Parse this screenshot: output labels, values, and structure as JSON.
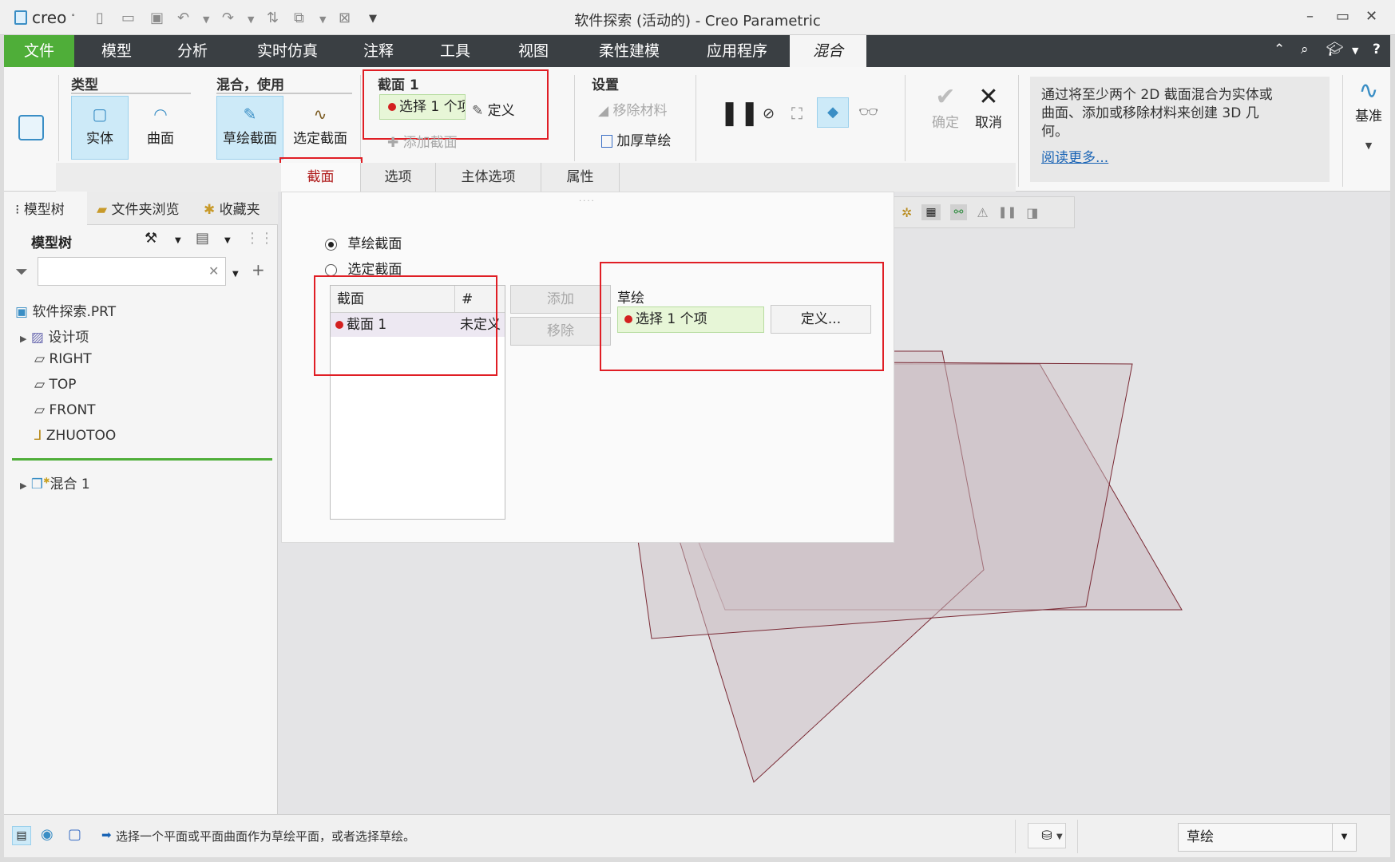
{
  "window": {
    "logo_text": "creo",
    "title": "软件探索 (活动的) - Creo Parametric",
    "minimize": "–",
    "maximize": "▭",
    "close": "✕"
  },
  "menu": {
    "items": [
      "文件",
      "模型",
      "分析",
      "实时仿真",
      "注释",
      "工具",
      "视图",
      "柔性建模",
      "应用程序",
      "混合"
    ]
  },
  "ribbon": {
    "type_group": {
      "title": "类型",
      "solid": "实体",
      "surface": "曲面"
    },
    "blend_group": {
      "title": "混合，使用",
      "sketch_section": "草绘截面",
      "selected_section": "选定截面"
    },
    "section_group": {
      "title": "截面 1",
      "select": "选择 1 个项",
      "define": "定义",
      "add_section": "添加截面"
    },
    "settings_group": {
      "title": "设置",
      "remove_material": "移除材料",
      "thicken_sketch": "加厚草绘"
    },
    "ok": "确定",
    "cancel": "取消",
    "datum": "基准"
  },
  "subtabs": [
    "截面",
    "选项",
    "主体选项",
    "属性"
  ],
  "help": {
    "text": "通过将至少两个 2D 截面混合为实体或曲面、添加或移除材料来创建 3D 几何。",
    "link": "阅读更多..."
  },
  "left_panel": {
    "tabs": [
      "模型树",
      "文件夹浏览",
      "收藏夹"
    ],
    "header": "模型树",
    "filter_placeholder": "",
    "tree": [
      {
        "label": "软件探索.PRT",
        "indent": 0
      },
      {
        "label": "设计项",
        "indent": 1
      },
      {
        "label": "RIGHT",
        "indent": 1
      },
      {
        "label": "TOP",
        "indent": 1
      },
      {
        "label": "FRONT",
        "indent": 1
      },
      {
        "label": "ZHUOTOO",
        "indent": 1
      }
    ],
    "feature": "混合 1"
  },
  "section_panel": {
    "radio_sketch": "草绘截面",
    "radio_selected": "选定截面",
    "table_headers": [
      "截面",
      "#"
    ],
    "table_rows": [
      {
        "name": "截面 1",
        "status": "未定义"
      }
    ],
    "add": "添加",
    "remove": "移除",
    "sketch_label": "草绘",
    "sketch_select": "选择 1 个项",
    "define_btn": "定义..."
  },
  "status": {
    "message": "选择一个平面或平面曲面作为草绘平面，或者选择草绘。",
    "filter_value": "草绘"
  },
  "colors": {
    "accent_green": "#4fae39",
    "menu_bg": "#3a3f43",
    "highlight": "#e01e25"
  }
}
